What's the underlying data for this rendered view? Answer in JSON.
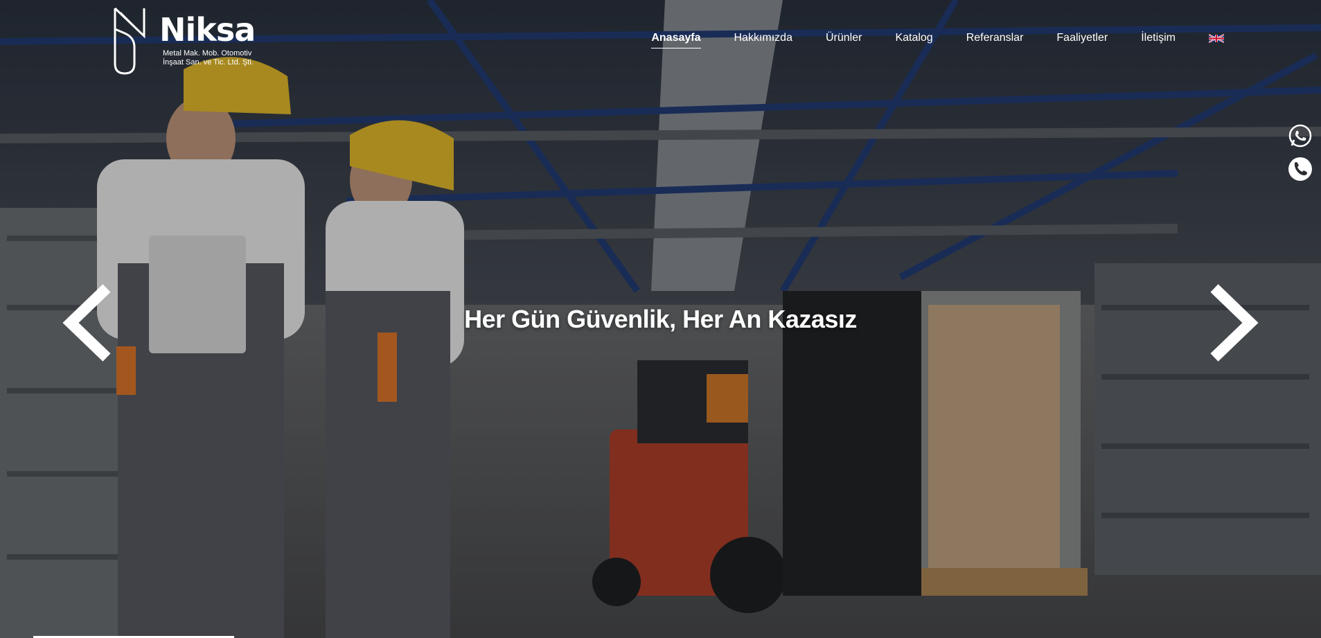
{
  "brand": {
    "name": "Niksa",
    "subtitle_line1": "Metal Mak. Mob. Otomotiv",
    "subtitle_line2": "İnşaat San. ve Tic. Ltd. Şti."
  },
  "nav": {
    "items": [
      {
        "label": "Anasayfa",
        "active": true
      },
      {
        "label": "Hakkımızda"
      },
      {
        "label": "Ürünler"
      },
      {
        "label": "Katalog"
      },
      {
        "label": "Referanslar"
      },
      {
        "label": "Faaliyetler"
      },
      {
        "label": "İletişim"
      }
    ],
    "language_icon": "uk-flag-icon"
  },
  "contact": {
    "icons": [
      "whatsapp-icon",
      "phone-icon"
    ]
  },
  "slider": {
    "caption": "Her Gün Güvenlik, Her An Kazasız",
    "prev_icon": "chevron-left-icon",
    "next_icon": "chevron-right-icon"
  },
  "colors": {
    "text": "#ffffff",
    "overlay": "#000000"
  }
}
